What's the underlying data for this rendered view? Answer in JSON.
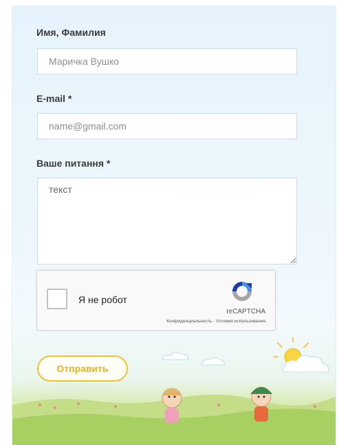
{
  "form": {
    "name_label": "Имя, Фамилия",
    "name_placeholder": "Маричка Вушко",
    "email_label": "E-mail *",
    "email_placeholder": "name@gmail.com",
    "message_label": "Ваше питання *",
    "message_placeholder": "текст",
    "submit_label": "Отправить"
  },
  "recaptcha": {
    "checkbox_label": "Я не робот",
    "brand": "reCAPTCHA",
    "links": "Конфиденциальность - Условия использования"
  },
  "colors": {
    "accent": "#f3c12c",
    "field_border": "#c9dceb",
    "background": "#e6f3fc",
    "grass": "#b8d77a"
  },
  "icons": {
    "recaptcha_logo": "recaptcha-logo-icon",
    "sun": "sun-icon",
    "cloud": "cloud-icon"
  }
}
